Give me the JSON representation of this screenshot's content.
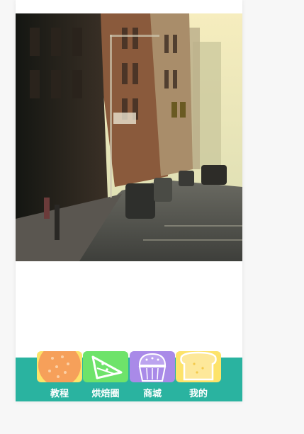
{
  "hero": {
    "image": "street-photo"
  },
  "tabbar": {
    "background": "#2ab3a0",
    "items": [
      {
        "label": "教程",
        "icon": "cookie-icon",
        "color": "#f6a05a"
      },
      {
        "label": "烘焙圈",
        "icon": "cake-slice-icon",
        "color": "#6ee36a"
      },
      {
        "label": "商城",
        "icon": "cupcake-icon",
        "color": "#a98ae8"
      },
      {
        "label": "我的",
        "icon": "bread-icon",
        "color": "#fde36a"
      }
    ]
  }
}
